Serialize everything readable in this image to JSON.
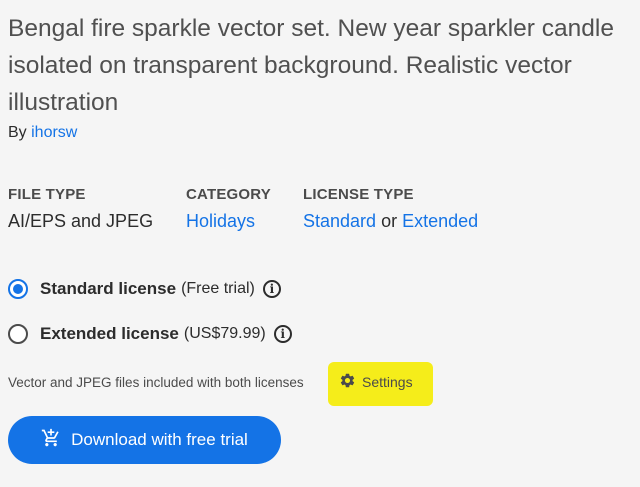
{
  "asset": {
    "title": "Bengal fire sparkle vector set. New year sparkler candle isolated on transparent background. Realistic vector illustration",
    "by_prefix": "By",
    "author": "ihorsw"
  },
  "meta": {
    "file_type_label": "FILE TYPE",
    "file_type_value": "AI/EPS and JPEG",
    "category_label": "CATEGORY",
    "category_value": "Holidays",
    "license_type_label": "LICENSE TYPE",
    "license_standard": "Standard",
    "license_or": "or",
    "license_extended": "Extended"
  },
  "licenses": [
    {
      "label": "Standard license",
      "detail": "(Free trial)",
      "selected": true
    },
    {
      "label": "Extended license",
      "detail": "(US$79.99)",
      "selected": false
    }
  ],
  "info_glyph": "i",
  "note": "Vector and JPEG files included with both licenses",
  "settings": {
    "label": "Settings",
    "icon": "gear-icon",
    "highlight_color": "#f5ed1a"
  },
  "download": {
    "label": "Download with free trial",
    "icon": "cart-add-icon"
  },
  "colors": {
    "accent": "#1473e6",
    "background": "#f5f5f5"
  }
}
